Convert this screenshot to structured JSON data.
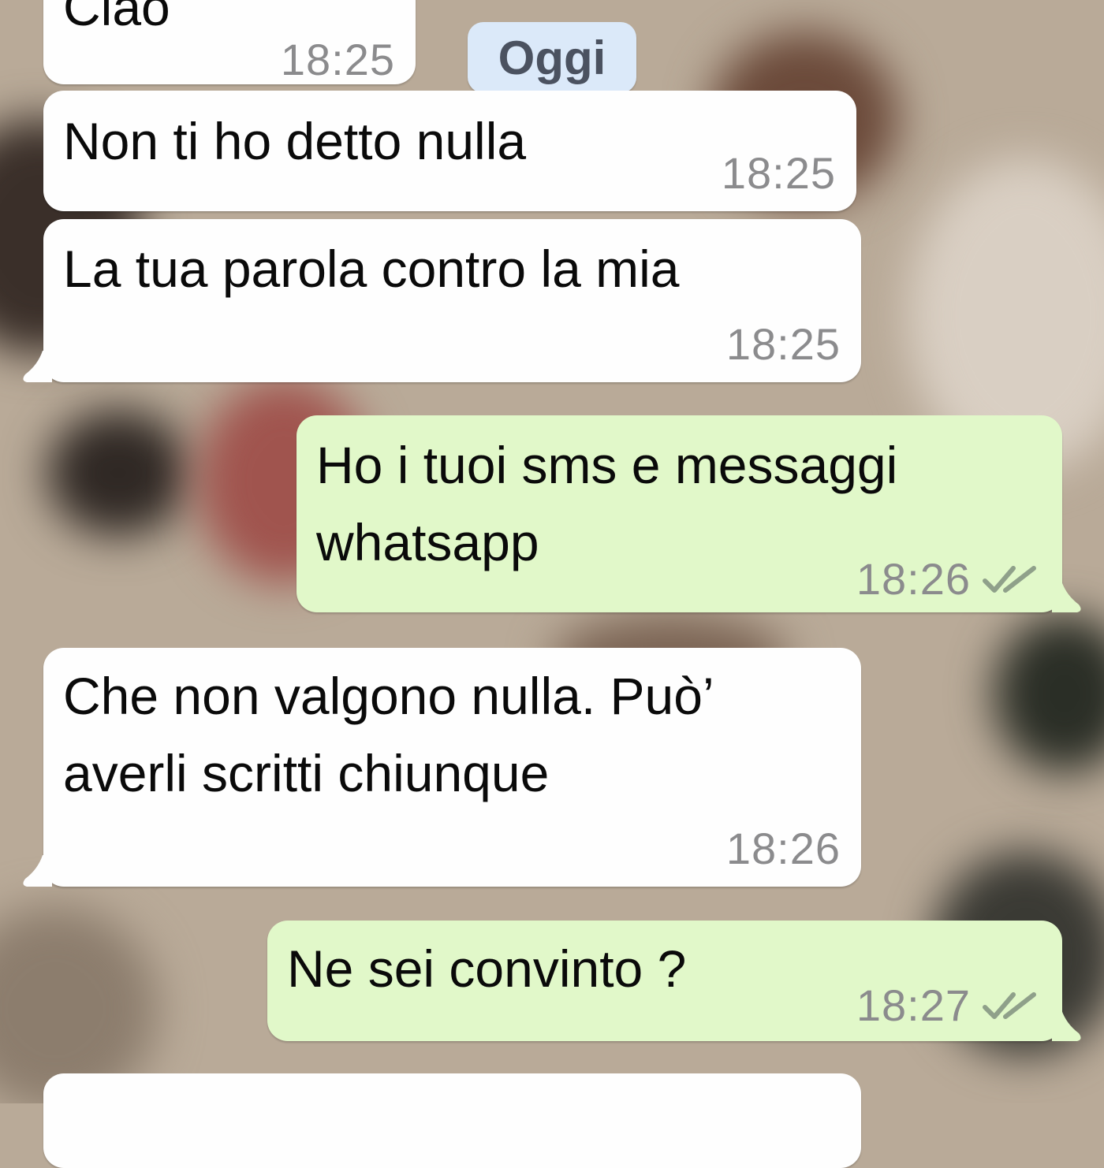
{
  "date_divider": "Oggi",
  "messages": [
    {
      "direction": "incoming",
      "text": "Ciao",
      "time": "18:25"
    },
    {
      "direction": "incoming",
      "text": "Non ti ho detto nulla",
      "time": "18:25"
    },
    {
      "direction": "incoming",
      "text": "La tua parola contro la mia",
      "time": "18:25"
    },
    {
      "direction": "outgoing",
      "text": "Ho i tuoi sms e messaggi\nwhatsapp",
      "time": "18:26",
      "status_icon": "double-check-read-icon"
    },
    {
      "direction": "incoming",
      "text": "Che non valgono nulla. Può’\naverli scritti chiunque",
      "time": "18:26"
    },
    {
      "direction": "outgoing",
      "text": "Ne sei convinto ?",
      "time": "18:27",
      "status_icon": "double-check-read-icon"
    }
  ],
  "colors": {
    "incoming_bubble": "#fefefe",
    "outgoing_bubble": "#e1f8c9",
    "date_pill": "#dbe9f9",
    "timestamp": "#8b8b8d",
    "tick": "#8fa08a"
  }
}
